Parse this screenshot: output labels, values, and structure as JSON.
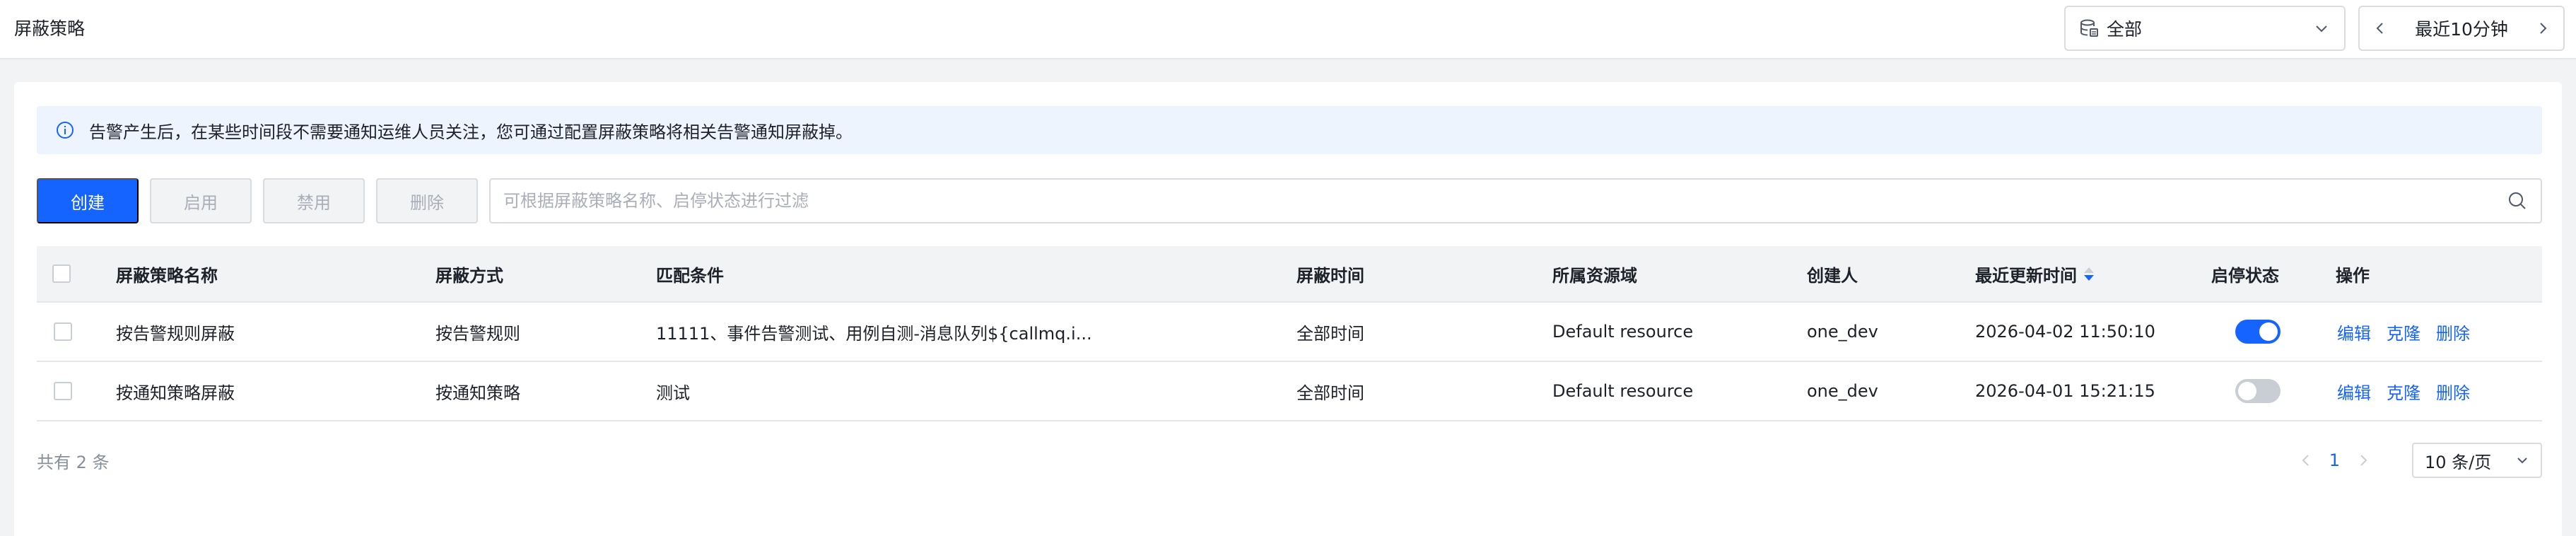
{
  "header": {
    "title": "屏蔽策略",
    "domain_select": {
      "value": "全部"
    },
    "time_picker": {
      "value": "最近10分钟"
    }
  },
  "alert": {
    "text": "告警产生后，在某些时间段不需要通知运维人员关注，您可通过配置屏蔽策略将相关告警通知屏蔽掉。"
  },
  "toolbar": {
    "create_label": "创建",
    "enable_label": "启用",
    "disable_label": "禁用",
    "delete_label": "删除",
    "search_placeholder": "可根据屏蔽策略名称、启停状态进行过滤"
  },
  "table": {
    "columns": {
      "name": "屏蔽策略名称",
      "method": "屏蔽方式",
      "condition": "匹配条件",
      "time": "屏蔽时间",
      "domain": "所属资源域",
      "creator": "创建人",
      "updated": "最近更新时间",
      "status": "启停状态",
      "actions": "操作"
    },
    "rows": [
      {
        "name": "按告警规则屏蔽",
        "method": "按告警规则",
        "condition": "11111、事件告警测试、用例自测-消息队列${callmq.i...",
        "time": "全部时间",
        "domain": "Default resource",
        "creator": "one_dev",
        "updated": "2026-04-02 11:50:10",
        "enabled": true,
        "edit": "编辑",
        "clone": "克隆",
        "delete": "删除"
      },
      {
        "name": "按通知策略屏蔽",
        "method": "按通知策略",
        "condition": "测试",
        "time": "全部时间",
        "domain": "Default resource",
        "creator": "one_dev",
        "updated": "2026-04-01 15:21:15",
        "enabled": false,
        "edit": "编辑",
        "clone": "克隆",
        "delete": "删除"
      }
    ]
  },
  "footer": {
    "total": "共有 2 条",
    "current_page": "1",
    "page_size": "10 条/页"
  },
  "colors": {
    "primary": "#1664ff",
    "alert_bg": "#eef4fe",
    "toggle_off": "#c9cdd4"
  }
}
